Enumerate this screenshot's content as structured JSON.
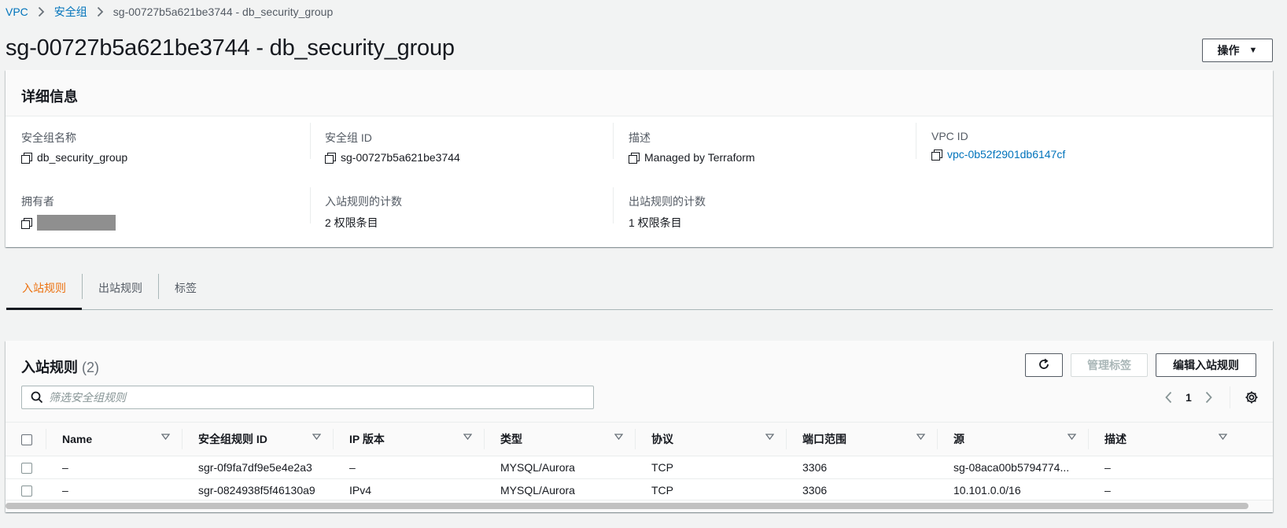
{
  "breadcrumb": {
    "items": [
      "VPC",
      "安全组"
    ],
    "current": "sg-00727b5a621be3744 - db_security_group"
  },
  "page_title": "sg-00727b5a621be3744 - db_security_group",
  "actions_label": "操作",
  "details": {
    "title": "详细信息",
    "fields": {
      "sg_name": {
        "label": "安全组名称",
        "value": "db_security_group"
      },
      "sg_id": {
        "label": "安全组 ID",
        "value": "sg-00727b5a621be3744"
      },
      "description": {
        "label": "描述",
        "value": "Managed by Terraform"
      },
      "vpc_id": {
        "label": "VPC ID",
        "value": "vpc-0b52f2901db6147cf"
      },
      "owner": {
        "label": "拥有者",
        "value": ""
      },
      "inbound_count": {
        "label": "入站规则的计数",
        "value": "2 权限条目"
      },
      "outbound_count": {
        "label": "出站规则的计数",
        "value": "1 权限条目"
      }
    }
  },
  "tabs": [
    {
      "label": "入站规则",
      "active": true
    },
    {
      "label": "出站规则",
      "active": false
    },
    {
      "label": "标签",
      "active": false
    }
  ],
  "rules": {
    "title": "入站规则",
    "count": "(2)",
    "manage_tags_label": "管理标签",
    "edit_label": "编辑入站规则",
    "search_placeholder": "筛选安全组规则",
    "page": "1",
    "columns": [
      "Name",
      "安全组规则 ID",
      "IP 版本",
      "类型",
      "协议",
      "端口范围",
      "源",
      "描述"
    ],
    "rows": [
      [
        "–",
        "sgr-0f9fa7df9e5e4e2a3",
        "–",
        "MYSQL/Aurora",
        "TCP",
        "3306",
        "sg-08aca00b5794774...",
        "–"
      ],
      [
        "–",
        "sgr-0824938f5f46130a9",
        "IPv4",
        "MYSQL/Aurora",
        "TCP",
        "3306",
        "10.101.0.0/16",
        "–"
      ]
    ]
  },
  "colors": {
    "link": "#0073bb",
    "active_tab": "#ec7211",
    "text": "#16191f"
  }
}
